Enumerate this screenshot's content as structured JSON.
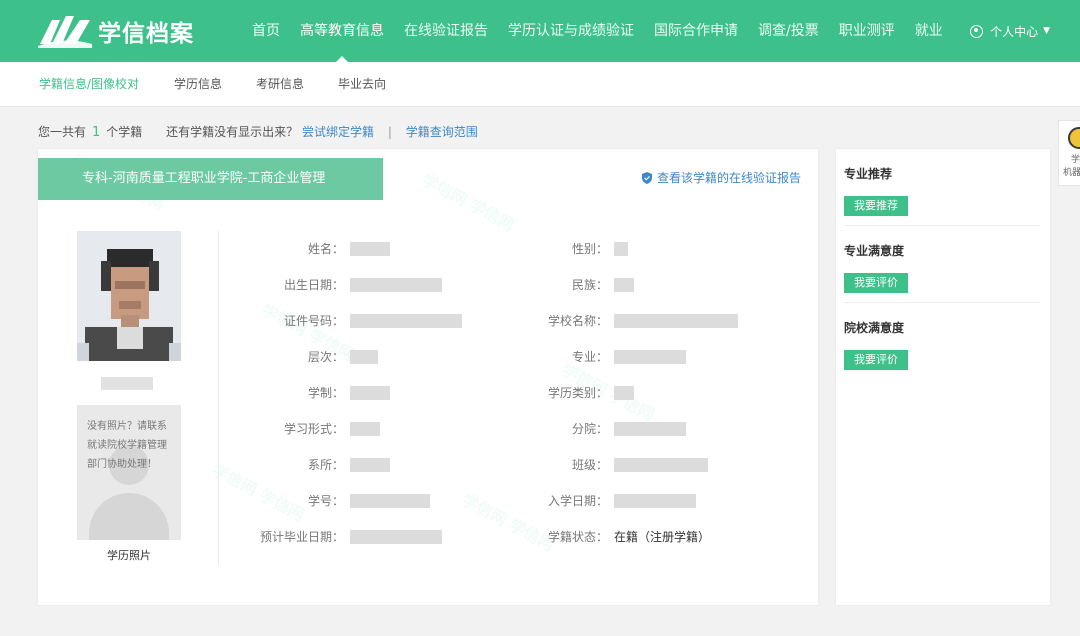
{
  "header": {
    "logo_text": "学信档案",
    "nav": [
      {
        "label": "首页"
      },
      {
        "label": "高等教育信息",
        "active": true
      },
      {
        "label": "在线验证报告"
      },
      {
        "label": "学历认证与成绩验证"
      },
      {
        "label": "国际合作申请"
      },
      {
        "label": "调查/投票"
      },
      {
        "label": "职业测评"
      },
      {
        "label": "就业"
      }
    ],
    "user_center": "个人中心",
    "colors": {
      "brand": "#3ec08a",
      "link": "#3e88c8"
    }
  },
  "subnav": [
    {
      "label": "学籍信息/图像校对",
      "active": true
    },
    {
      "label": "学历信息"
    },
    {
      "label": "考研信息"
    },
    {
      "label": "毕业去向"
    }
  ],
  "info": {
    "prefix": "您一共有",
    "count": "1",
    "suffix": "个学籍",
    "question": "还有学籍没有显示出来？",
    "bind_link": "尝试绑定学籍",
    "separator": "|",
    "scope_link": "学籍查询范围"
  },
  "card": {
    "title": "专科-河南质量工程职业学院-工商企业管理",
    "report_link": "查看该学籍的在线验证报告",
    "placeholder_text": "没有照片？请联系就读院校学籍管理部门协助处理！",
    "photo_caption": "学历照片",
    "fields": {
      "name": {
        "label": "姓名："
      },
      "gender": {
        "label": "性别："
      },
      "birth": {
        "label": "出生日期："
      },
      "ethnicity": {
        "label": "民族："
      },
      "id_number": {
        "label": "证件号码："
      },
      "school": {
        "label": "学校名称："
      },
      "level": {
        "label": "层次："
      },
      "major": {
        "label": "专业："
      },
      "duration": {
        "label": "学制："
      },
      "edu_type": {
        "label": "学历类别："
      },
      "study_form": {
        "label": "学习形式："
      },
      "branch": {
        "label": "分院："
      },
      "department": {
        "label": "系所："
      },
      "class": {
        "label": "班级："
      },
      "student_id": {
        "label": "学号："
      },
      "enroll_date": {
        "label": "入学日期："
      },
      "grad_date": {
        "label": "预计毕业日期："
      },
      "status": {
        "label": "学籍状态：",
        "value": "在籍（注册学籍）"
      }
    }
  },
  "sidebar": {
    "sections": [
      {
        "title": "专业推荐",
        "button": "我要推荐"
      },
      {
        "title": "专业满意度",
        "button": "我要评价"
      },
      {
        "title": "院校满意度",
        "button": "我要评价"
      }
    ]
  },
  "float_widget": {
    "line1": "学",
    "line2": "机器"
  }
}
